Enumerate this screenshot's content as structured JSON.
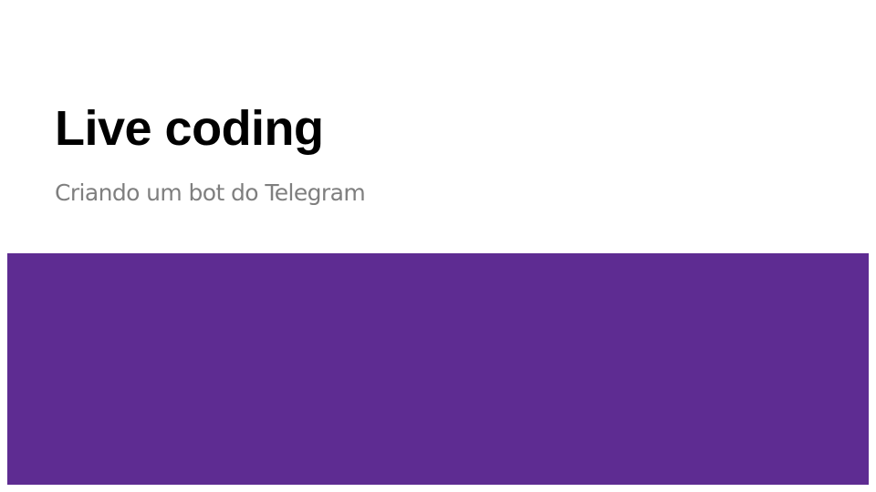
{
  "slide": {
    "title": "Live coding",
    "subtitle": "Criando um bot do Telegram",
    "colors": {
      "background": "#ffffff",
      "title": "#000000",
      "subtitle": "#7f7f7f",
      "band": "#5e2c92"
    }
  }
}
